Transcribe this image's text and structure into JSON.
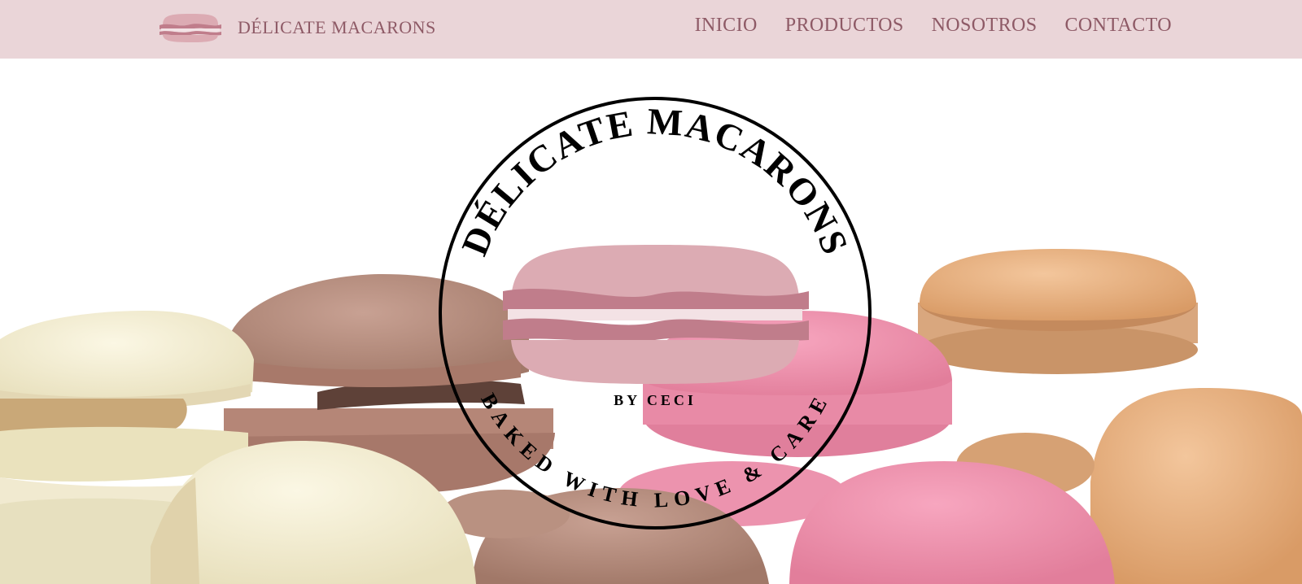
{
  "header": {
    "brand_name": "DÉLICATE MACARONS",
    "nav_links": [
      "INICIO",
      "PRODUCTOS",
      "NOSOTROS",
      "CONTACTO"
    ]
  },
  "hero": {
    "emblem": {
      "top_text": "DÉLICATE MACARONS",
      "subtitle": "BY CECI",
      "bottom_text": "BAKED WITH LOVE & CARE"
    }
  },
  "colors": {
    "navbar_bg": "#ead5d8",
    "nav_text": "#8e5a66",
    "macaron_shell": "#dcabb3",
    "macaron_filling": "#c07d8b",
    "emblem_ink": "#000000"
  },
  "icons": {
    "brand_logo": "macaron-icon"
  }
}
